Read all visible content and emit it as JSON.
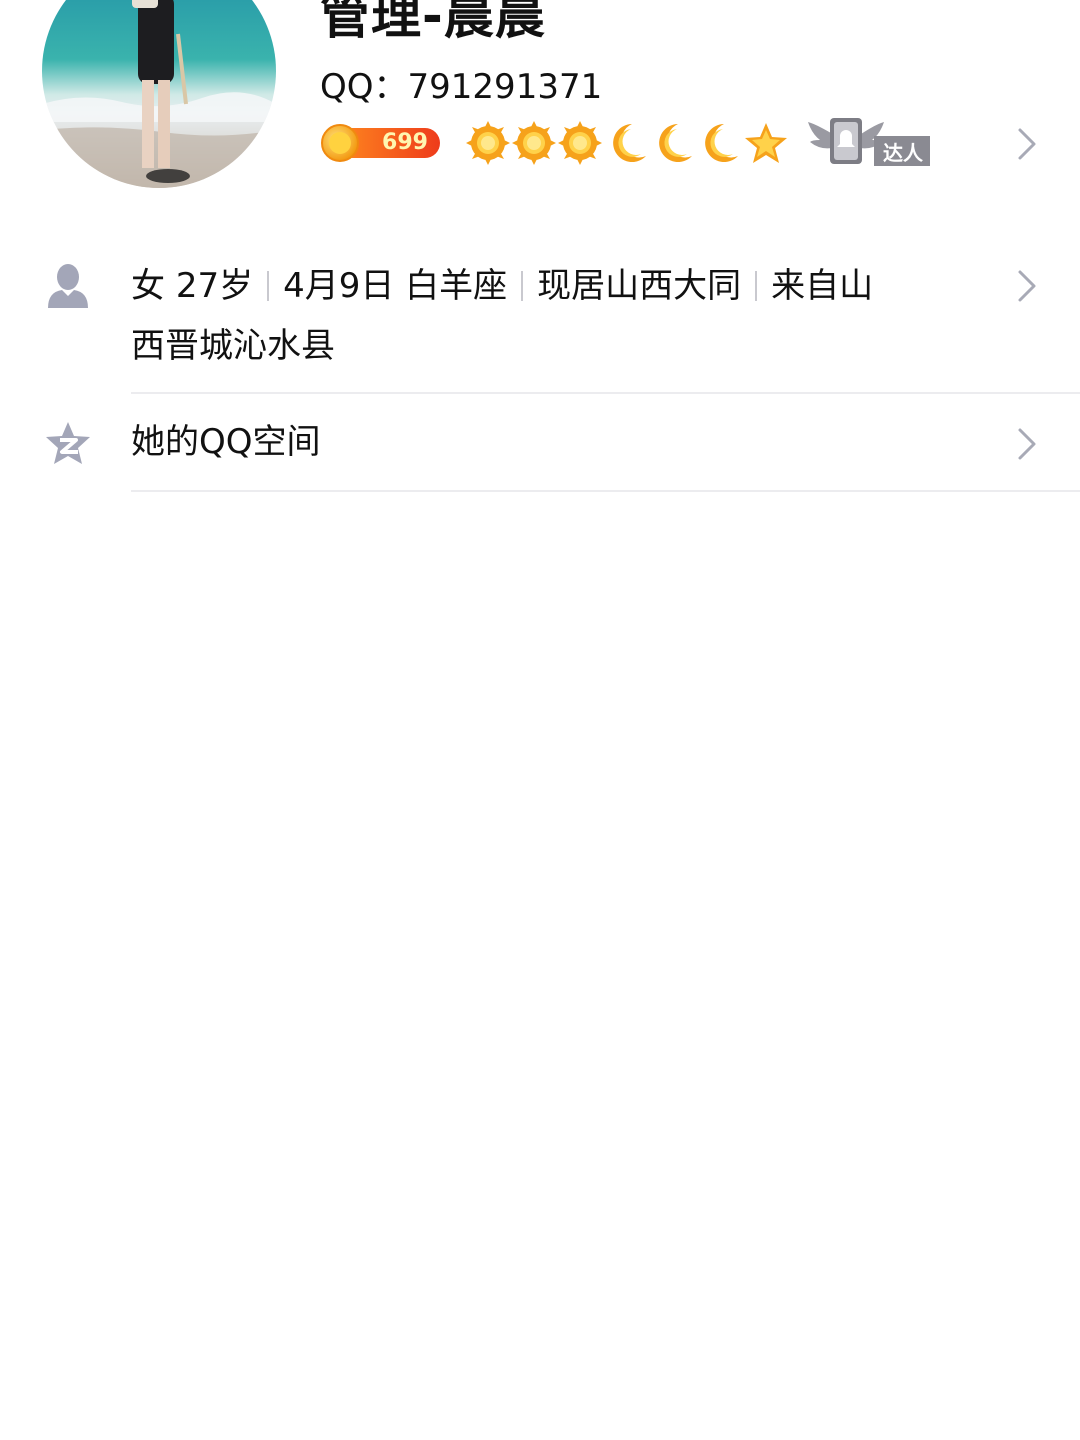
{
  "profile": {
    "name": "管理-晨晨",
    "qq_label": "QQ：",
    "qq_number": "791291371",
    "level_number": "699",
    "level_icons": [
      "sun-icon",
      "sun-icon",
      "sun-icon",
      "moon-icon",
      "moon-icon",
      "moon-icon",
      "star-icon"
    ],
    "expert_badge": "达人"
  },
  "info": {
    "gender": "女",
    "age": "27岁",
    "birthday": "4月9日",
    "zodiac": "白羊座",
    "residence": "现居山西大同",
    "hometown_part1": "来自山",
    "hometown_part2": "西晋城沁水县"
  },
  "qzone": {
    "label": "她的QQ空间"
  },
  "colors": {
    "accent_orange": "#f5a623",
    "level_red": "#f04a1e",
    "icon_gray": "#a3a6b8",
    "divider": "#ececef"
  }
}
